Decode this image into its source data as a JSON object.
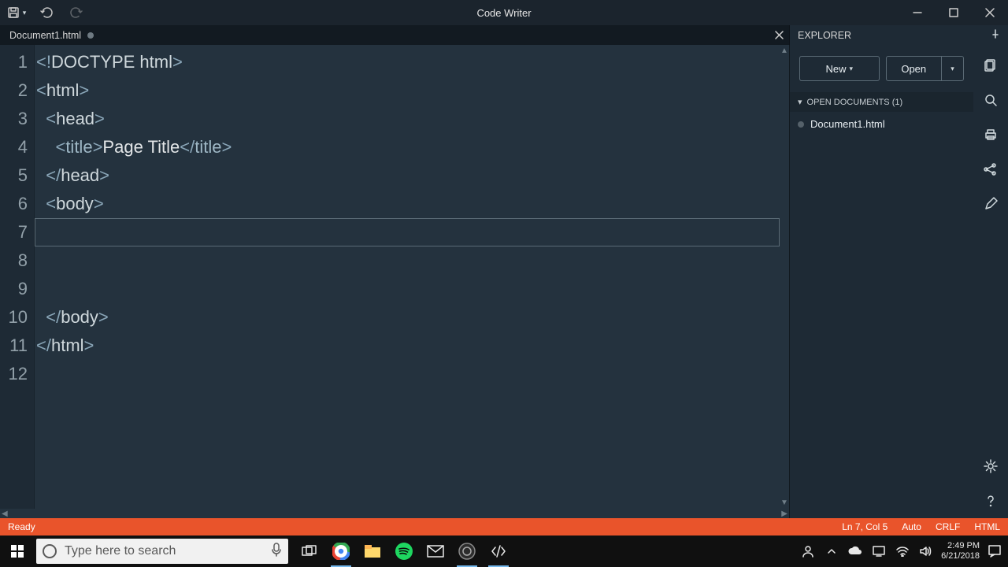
{
  "window": {
    "title": "Code Writer"
  },
  "tabs": {
    "doc_name": "Document1.html"
  },
  "explorer": {
    "title": "EXPLORER",
    "new_label": "New",
    "open_label": "Open",
    "section_label": "OPEN DOCUMENTS (1)",
    "file_name": "Document1.html"
  },
  "code": {
    "lines": [
      {
        "n": "1",
        "html": "<span class='pun'>&lt;!</span><span class='tag'>DOCTYPE html</span><span class='pun'>&gt;</span>"
      },
      {
        "n": "2",
        "html": "<span class='pun'>&lt;</span><span class='tag'>html</span><span class='pun'>&gt;</span>"
      },
      {
        "n": "3",
        "html": "  <span class='pun'>&lt;</span><span class='tag'>head</span><span class='pun'>&gt;</span>"
      },
      {
        "n": "4",
        "html": "    <span class='pun'>&lt;</span><span class='nm'>title</span><span class='pun'>&gt;</span><span class='txt'>Page Title</span><span class='pun'>&lt;/</span><span class='nm'>title</span><span class='pun'>&gt;</span>"
      },
      {
        "n": "5",
        "html": "  <span class='pun'>&lt;/</span><span class='tag'>head</span><span class='pun'>&gt;</span>"
      },
      {
        "n": "6",
        "html": "  <span class='pun'>&lt;</span><span class='tag'>body</span><span class='pun'>&gt;</span>"
      },
      {
        "n": "7",
        "html": ""
      },
      {
        "n": "8",
        "html": ""
      },
      {
        "n": "9",
        "html": ""
      },
      {
        "n": "10",
        "html": "  <span class='pun'>&lt;/</span><span class='tag'>body</span><span class='pun'>&gt;</span>"
      },
      {
        "n": "11",
        "html": "<span class='pun'>&lt;/</span><span class='tag'>html</span><span class='pun'>&gt;</span>"
      },
      {
        "n": "12",
        "html": ""
      }
    ],
    "current_line_index": 6
  },
  "status": {
    "ready": "Ready",
    "cursor": "Ln 7, Col 5",
    "enc": "Auto",
    "eol": "CRLF",
    "lang": "HTML"
  },
  "taskbar": {
    "search_placeholder": "Type here to search",
    "clock_time": "2:49 PM",
    "clock_date": "6/21/2018"
  }
}
